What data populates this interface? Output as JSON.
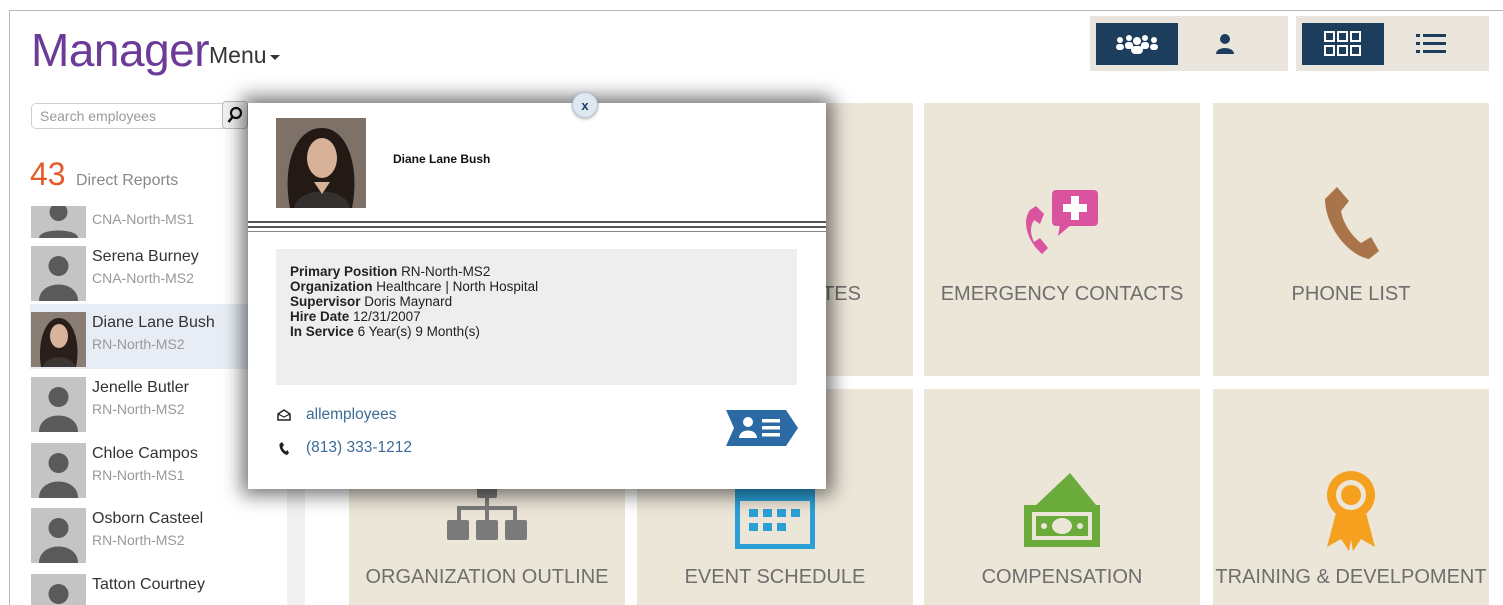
{
  "header": {
    "title": "Manager",
    "menu_label": "Menu",
    "toolbar": [
      {
        "name": "team-view",
        "icon": "group-icon",
        "active": true
      },
      {
        "name": "single-view",
        "icon": "person-icon",
        "active": false
      },
      {
        "name": "grid-view",
        "icon": "grid-icon",
        "active": true
      },
      {
        "name": "list-view",
        "icon": "list-icon",
        "active": false
      }
    ]
  },
  "sidebar": {
    "search_placeholder": "Search employees",
    "direct_reports_count": "43",
    "direct_reports_label": "Direct Reports",
    "employees": [
      {
        "name": "",
        "position": "CNA-North-MS1"
      },
      {
        "name": "Serena Burney",
        "position": "CNA-North-MS2"
      },
      {
        "name": "Diane Lane Bush",
        "position": "RN-North-MS2"
      },
      {
        "name": "Jenelle Butler",
        "position": "RN-North-MS2"
      },
      {
        "name": "Chloe Campos",
        "position": "RN-North-MS1"
      },
      {
        "name": "Osborn Casteel",
        "position": "RN-North-MS2"
      },
      {
        "name": "Tatton Courtney",
        "position": ""
      }
    ]
  },
  "tiles": {
    "notes_partial": "TES",
    "emergency_contacts": "EMERGENCY CONTACTS",
    "phone_list": "PHONE LIST",
    "organization_outline": "ORGANIZATION OUTLINE",
    "event_schedule": "EVENT SCHEDULE",
    "compensation": "COMPENSATION",
    "training": "TRAINING & DEVELPOMENT"
  },
  "modal": {
    "close_label": "x",
    "employee_name": "Diane Lane Bush",
    "details": {
      "primary_position_label": "Primary Position",
      "primary_position": "RN-North-MS2",
      "organization_label": "Organization",
      "organization": "Healthcare | North Hospital",
      "supervisor_label": "Supervisor",
      "supervisor": "Doris Maynard",
      "hire_date_label": "Hire Date",
      "hire_date": "12/31/2007",
      "in_service_label": "In Service",
      "in_service": "6 Year(s) 9 Month(s)"
    },
    "email": "allemployees",
    "phone": "(813) 333-1212"
  },
  "colors": {
    "brand_purple": "#6b3b97",
    "accent_orange": "#e55a2b",
    "navy": "#1d3d5c",
    "tile_bg": "#ece6d9",
    "emergency_pink": "#d9539f",
    "phone_brown": "#a9744a",
    "event_blue": "#2aa0d6",
    "comp_green": "#6aab3b",
    "training_orange": "#f5a01e",
    "link_blue": "#3d6b96"
  }
}
